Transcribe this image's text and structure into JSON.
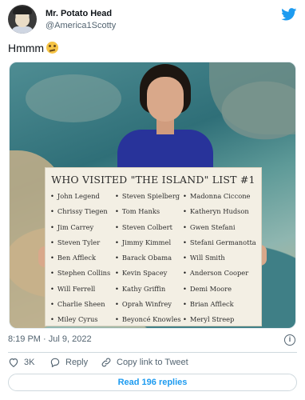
{
  "author": {
    "name": "Mr. Potato Head",
    "handle": "@America1Scotty"
  },
  "tweet": {
    "text": "Hmmm",
    "emoji_icon": "thinking-face-emoji"
  },
  "media": {
    "sign_title": "WHO VISITED \"THE ISLAND\" LIST #1",
    "column1": [
      "John Legend",
      "Chrissy Tiegen",
      "Jim Carrey",
      "Steven Tyler",
      "Ben Affleck",
      "Stephen Collins",
      "Will Ferrell",
      "Charlie Sheen",
      "Miley Cyrus"
    ],
    "column2": [
      "Steven Spielberg",
      "Tom Hanks",
      "Steven Colbert",
      "Jimmy Kimmel",
      "Barack Obama",
      "Kevin Spacey",
      "Kathy Griffin",
      "Oprah Winfrey",
      "Beyoncé Knowles"
    ],
    "column3": [
      "Madonna Ciccone",
      "Katheryn Hudson",
      "Gwen Stefani",
      "Stefani Germanotta",
      "Will Smith",
      "Anderson Cooper",
      "Demi Moore",
      "Brian Affleck",
      "Meryl Streep"
    ]
  },
  "timestamp": "8:19 PM · Jul 9, 2022",
  "actions": {
    "like_count": "3K",
    "reply_label": "Reply",
    "copy_label": "Copy link to Tweet"
  },
  "read_replies_label": "Read 196 replies",
  "colors": {
    "accent": "#1d9bf0",
    "text": "#0f1419",
    "muted": "#536471",
    "border": "#cfd9de"
  },
  "icons": {
    "brand": "twitter-bird-icon",
    "info": "info-icon",
    "like": "heart-icon",
    "reply": "reply-bubble-icon",
    "copy": "link-icon"
  }
}
